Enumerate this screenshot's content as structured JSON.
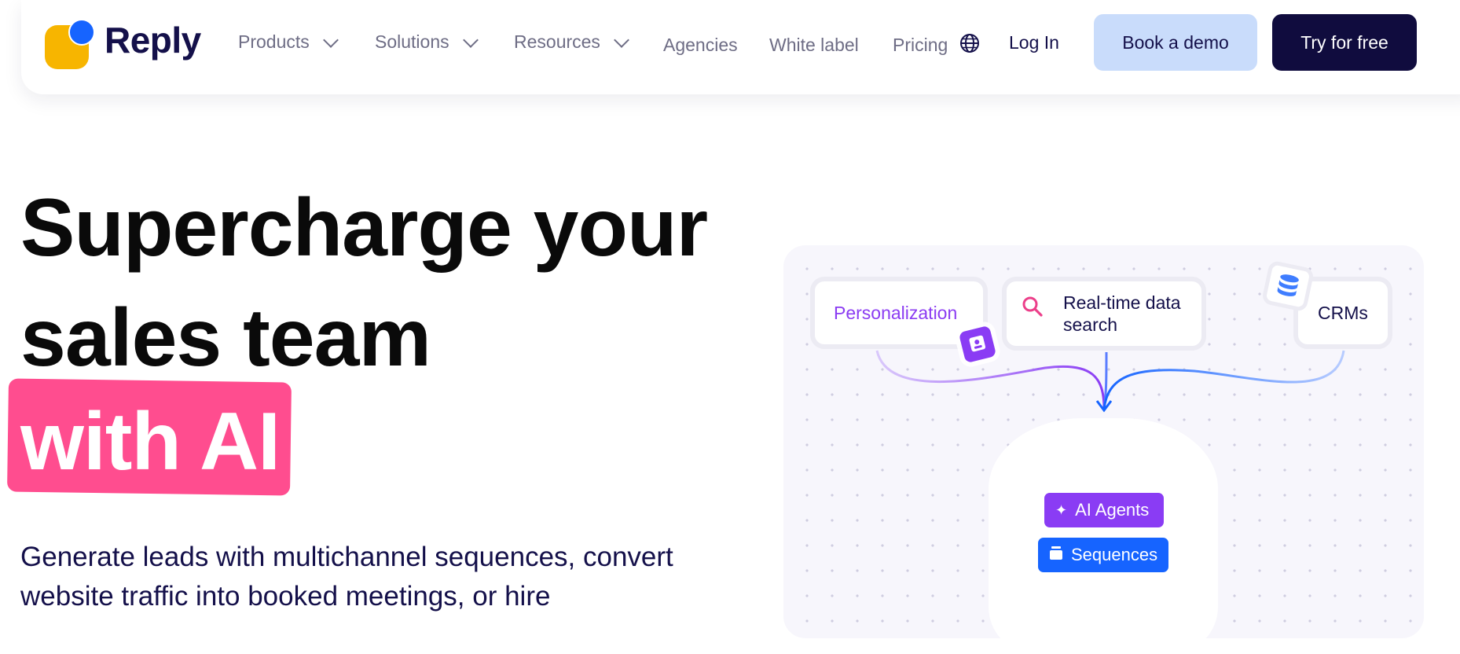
{
  "nav": {
    "brand": "Reply",
    "items": [
      {
        "label": "Products",
        "dropdown": true
      },
      {
        "label": "Solutions",
        "dropdown": true
      },
      {
        "label": "Resources",
        "dropdown": true
      },
      {
        "label": "Agencies"
      },
      {
        "label": "White label"
      },
      {
        "label": "Pricing"
      }
    ],
    "language_icon": "globe-icon",
    "login": "Log In",
    "book_demo": "Book a demo",
    "try_free": "Try for free"
  },
  "hero": {
    "line1": "Supercharge your",
    "line2": "sales team",
    "highlight": "with AI",
    "subtitle": "Generate leads with multichannel sequences, convert website traffic into booked meetings, or hire"
  },
  "diagram": {
    "sources": [
      "Personalization",
      "Real-time data search",
      "CRMs"
    ],
    "engine": [
      "AI Agents",
      "Sequences"
    ]
  },
  "colors": {
    "brand_yellow": "#f7b500",
    "brand_blue": "#1664ff",
    "navy": "#100c3e",
    "demo_bg": "#c9dcfb",
    "highlight_pink": "#ff4d8f",
    "purple": "#8a3cf4"
  }
}
